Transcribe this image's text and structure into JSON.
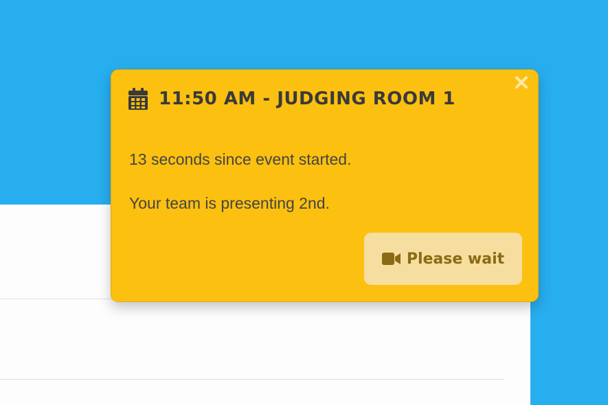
{
  "toast": {
    "title": "11:50 AM - JUDGING ROOM 1",
    "elapsed_message": "13 seconds since event started.",
    "presentation_message": "Your team is presenting 2nd.",
    "wait_button_label": "Please wait",
    "icons": {
      "header": "calendar-icon",
      "button": "video-camera-icon",
      "close": "close-icon"
    },
    "colors": {
      "background": "#fcc010",
      "text": "#3a3a3a",
      "button_background": "#f6dea0",
      "button_text": "#8a6a14"
    }
  },
  "page": {
    "colors": {
      "background": "#27aeef",
      "panel": "#fdfdfe"
    }
  }
}
